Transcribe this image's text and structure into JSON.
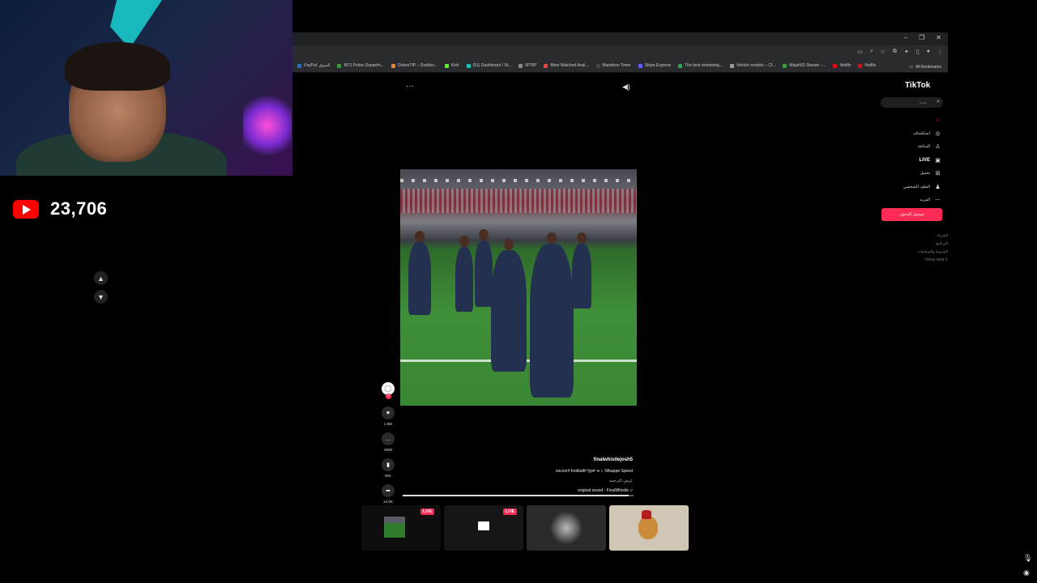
{
  "stream": {
    "subscriber_count": "23,706"
  },
  "browser": {
    "window_controls": [
      "–",
      "❐",
      "✕"
    ],
    "bookmarks": [
      {
        "label": "PayPal: السوق",
        "color": "#1e6fd1"
      },
      {
        "label": "MTJ Police Departm...",
        "color": "#3b9c3b"
      },
      {
        "label": "DokenTIP – Dashbo...",
        "color": "#e8852a"
      },
      {
        "label": "Kick",
        "color": "#53fc18"
      },
      {
        "label": "(51) Dashboard / St...",
        "color": "#17c3b2"
      },
      {
        "label": "MTRP",
        "color": "#888888"
      },
      {
        "label": "Most Watched Anal...",
        "color": "#f33f3f"
      },
      {
        "label": "Marathon Timer",
        "color": "#444444"
      },
      {
        "label": "Stripe Express",
        "color": "#635bff"
      },
      {
        "label": "The best streaming...",
        "color": "#2ba84a"
      },
      {
        "label": "Vehicle models – Cf...",
        "color": "#999999"
      },
      {
        "label": "Majah92 Stream –...",
        "color": "#3b9c3b"
      },
      {
        "label": "Netflix",
        "color": "#e50914"
      },
      {
        "label": "Netflix",
        "color": "#e50914"
      }
    ],
    "all_bookmarks": "All Bookmarks"
  },
  "tiktok": {
    "logo": "TikTok",
    "search_placeholder": "بحث",
    "nav": [
      {
        "label": "",
        "icon": "home-icon",
        "glyph": "⌂"
      },
      {
        "label": "استكشاف",
        "icon": "compass-icon",
        "glyph": "◎"
      },
      {
        "label": "المتابَعة",
        "icon": "user-follow-icon",
        "glyph": "♙"
      },
      {
        "label": "LIVE",
        "icon": "live-icon",
        "glyph": "▣"
      },
      {
        "label": "تحميل",
        "icon": "upload-icon",
        "glyph": "⊞"
      },
      {
        "label": "الملف الشخصي",
        "icon": "profile-icon",
        "glyph": "♟"
      },
      {
        "label": "المزيد",
        "icon": "more-icon",
        "glyph": "⋯"
      }
    ],
    "login_button": "تسجيل الدخول",
    "footer": [
      "الشركة",
      "البرنامج",
      "الشروط والسياسات",
      "TikTok 2025 ©"
    ],
    "page_dots": "···",
    "volume_glyph": "◀)"
  },
  "video": {
    "username": "finalwhistlejosh5",
    "description": "soccer# football# fyp# ➜ ١ :Mbappe Speed",
    "see_translation": "عرض الترجمة",
    "sound": "original sound - FinalWhistle ♫",
    "progress": 0.98,
    "actions": [
      {
        "name": "like",
        "glyph": "♥",
        "count": "1.9M"
      },
      {
        "name": "comment",
        "glyph": "…",
        "count": "3600"
      },
      {
        "name": "bookmark",
        "glyph": "▮",
        "count": "92K"
      },
      {
        "name": "share",
        "glyph": "➦",
        "count": "14.6K"
      }
    ]
  },
  "thumbnails": [
    {
      "live": "LIVE"
    },
    {
      "live": "LIVE"
    },
    {
      "live": ""
    },
    {
      "live": ""
    }
  ],
  "colors": {
    "tiktok_red": "#fe2c55",
    "youtube_red": "#ff0000"
  }
}
